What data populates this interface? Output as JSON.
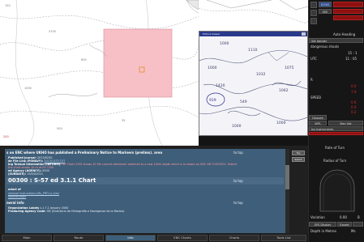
{
  "chart": {
    "depth_labels": [
      "150",
      "4700",
      "600",
      "1000",
      "35",
      "500",
      "200"
    ]
  },
  "inset": {
    "title": "Picture Viewer",
    "soundings": [
      "1000",
      "1110",
      "1032",
      "1075",
      "1062",
      "1420",
      "549",
      "919",
      "1000",
      "1000",
      "1000"
    ]
  },
  "right_panel": {
    "top_buttons": [
      "ECDIS",
      "SEE ALL"
    ],
    "labels": {
      "set_depth": "Auto Heading",
      "chart_danger": "Set danger",
      "dangerous": "dangerous shoals",
      "time1": "15 : 1",
      "utc": "UTC",
      "time2": "11 : 05",
      "a1": "R",
      "a2": "0.0",
      "a3": "7.9",
      "ship_mode": "SPEED",
      "rates": "0 K",
      "rate2": "0.0",
      "rate3": "0.2",
      "dispute": "Dispute",
      "wpl": "WPL",
      "man_set": "Man Set",
      "instruments": "Ins Instruments",
      "rate_of_turn": "Rate of Turn",
      "radius": "Radius of Turn",
      "variation": "Variation",
      "var_val": "0.00",
      "bl": "B",
      "ssd": "SYS Display",
      "expert": "Expert",
      "depth_under": "Depth in Metres",
      "depth_val": "Ms"
    }
  },
  "doc": {
    "line1": "s on ENC where UKHO has published a Preliminary Notice to Mariners (prelims). area",
    "line1_top": "to top",
    "line2_label": "Published Journal:",
    "line2_val": "2013/0230",
    "line3_label": "de File Link (PGNAVY):",
    "line3_link": "2013/1373.TXT",
    "line4_label": "ing Textual Information (INFORM):",
    "line4_text": "DE Chart 3195 shows 10 file current statement matched to a new 100m depth which is is shown on ENC GB 7U4T0301. Extent",
    "line4b": "the chart shows 10 m at F4 7200",
    "line5_label": "ed Agency (AGENCY):",
    "line5_val": "5500",
    "line6_label": "(SURDATE):",
    "line6_val": "19/03/2013",
    "heading2": "00300 : S-57 ed 3.1.1 Chart",
    "heading2_top": "to top",
    "line7_label": "oduct of",
    "line8_link": "rational Instructions (Ms_PRTL1).xtml",
    "line9_link": "sources.aspx",
    "line10": "neral info",
    "line10_top": "to top",
    "line11_label": "Organization Labels",
    "line11_val": "v.1.7.1 January 2000",
    "line12_label": "Producing Agency Code:",
    "line12_val": "GB (Directorio de Hidrografia e Navegacao da la Marina)",
    "btn1": "Top",
    "btn2": "Select"
  },
  "tabs": [
    "Main",
    "Route",
    "Info",
    "ENC Charts",
    "Charts",
    "Tools List"
  ]
}
